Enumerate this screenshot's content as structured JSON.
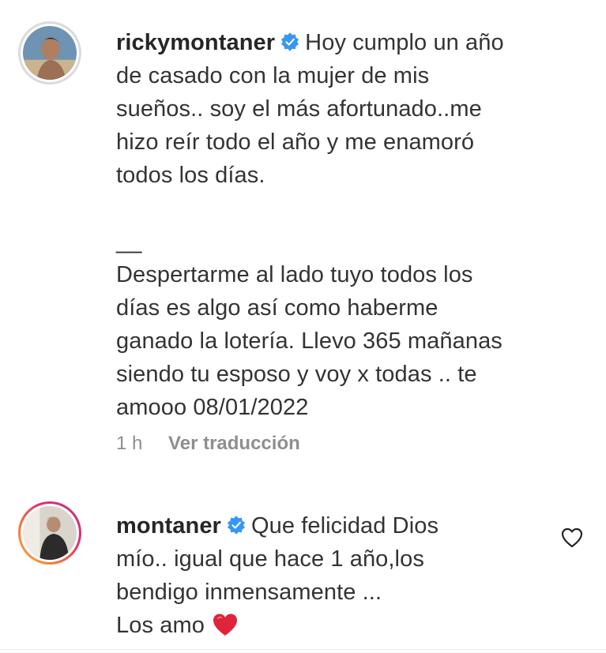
{
  "comments": [
    {
      "username": "rickymontaner",
      "verified": true,
      "text_lines": [
        "Hoy cumplo un año",
        "de casado con la mujer de mis",
        "sueños.. soy el más afortunado..me",
        "hizo reír todo el año y me enamoró",
        "todos los días."
      ],
      "separator": "__",
      "text_lines_2": [
        "Despertarme al lado tuyo todos los",
        "días es algo así como haberme",
        "ganado la lotería. Llevo 365 mañanas",
        "siendo tu esposo y voy x todas .. te",
        "amooo 08/01/2022"
      ],
      "time": "1 h",
      "translate_label": "Ver traducción"
    },
    {
      "username": "montaner",
      "verified": true,
      "text_lines": [
        "Que felicidad Dios",
        "mío.. igual que hace 1 año,los",
        "bendigo inmensamente ...",
        "Los amo"
      ],
      "emoji": "red-heart"
    }
  ],
  "icons": {
    "verified_badge": "verified-badge-icon",
    "like": "heart-outline-icon",
    "emoji": "red-heart-emoji-icon"
  },
  "colors": {
    "verified": "#3897f0",
    "text": "#262626",
    "meta": "#8e8e8e",
    "heart": "#ed4956"
  }
}
